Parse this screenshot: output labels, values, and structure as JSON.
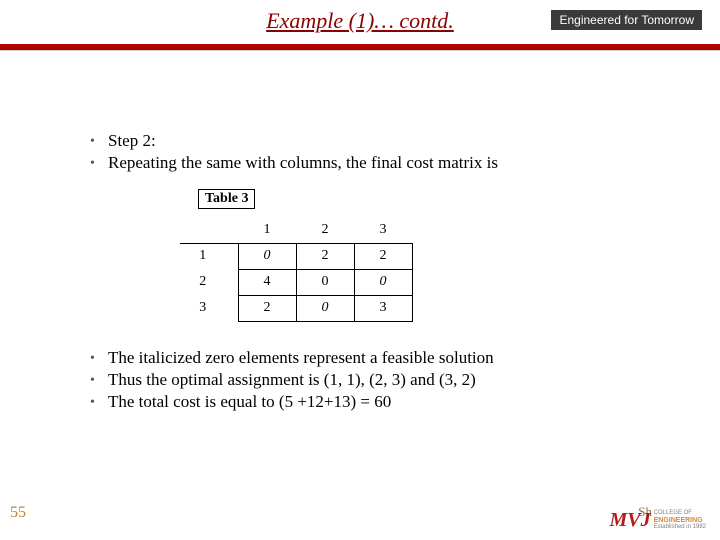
{
  "header": {
    "title": "Example (1)… contd.",
    "tagline": "Engineered for Tomorrow"
  },
  "bullets_top": [
    "Step 2:",
    "Repeating the same with columns, the final cost matrix is"
  ],
  "table": {
    "caption": "Table 3",
    "col_headers": [
      "1",
      "2",
      "3"
    ],
    "row_headers": [
      "1",
      "2",
      "3"
    ],
    "cells": [
      [
        {
          "v": "0",
          "i": true
        },
        {
          "v": "2",
          "i": false
        },
        {
          "v": "2",
          "i": false
        }
      ],
      [
        {
          "v": "4",
          "i": false
        },
        {
          "v": "0",
          "i": false
        },
        {
          "v": "0",
          "i": true
        }
      ],
      [
        {
          "v": "2",
          "i": false
        },
        {
          "v": "0",
          "i": true
        },
        {
          "v": "3",
          "i": false
        }
      ]
    ]
  },
  "bullets_bottom": [
    "The italicized zero elements represent a feasible solution",
    "Thus the optimal assignment is (1, 1), (2, 3) and (3, 2)",
    "The total cost is equal to (5 +12+13) = 60"
  ],
  "page_number": "55",
  "watermark_sub": "Sh",
  "logo": {
    "mark": "MVJ",
    "line1": "COLLEGE OF",
    "line2": "ENGINEERING",
    "line3": "Established in 1982"
  }
}
